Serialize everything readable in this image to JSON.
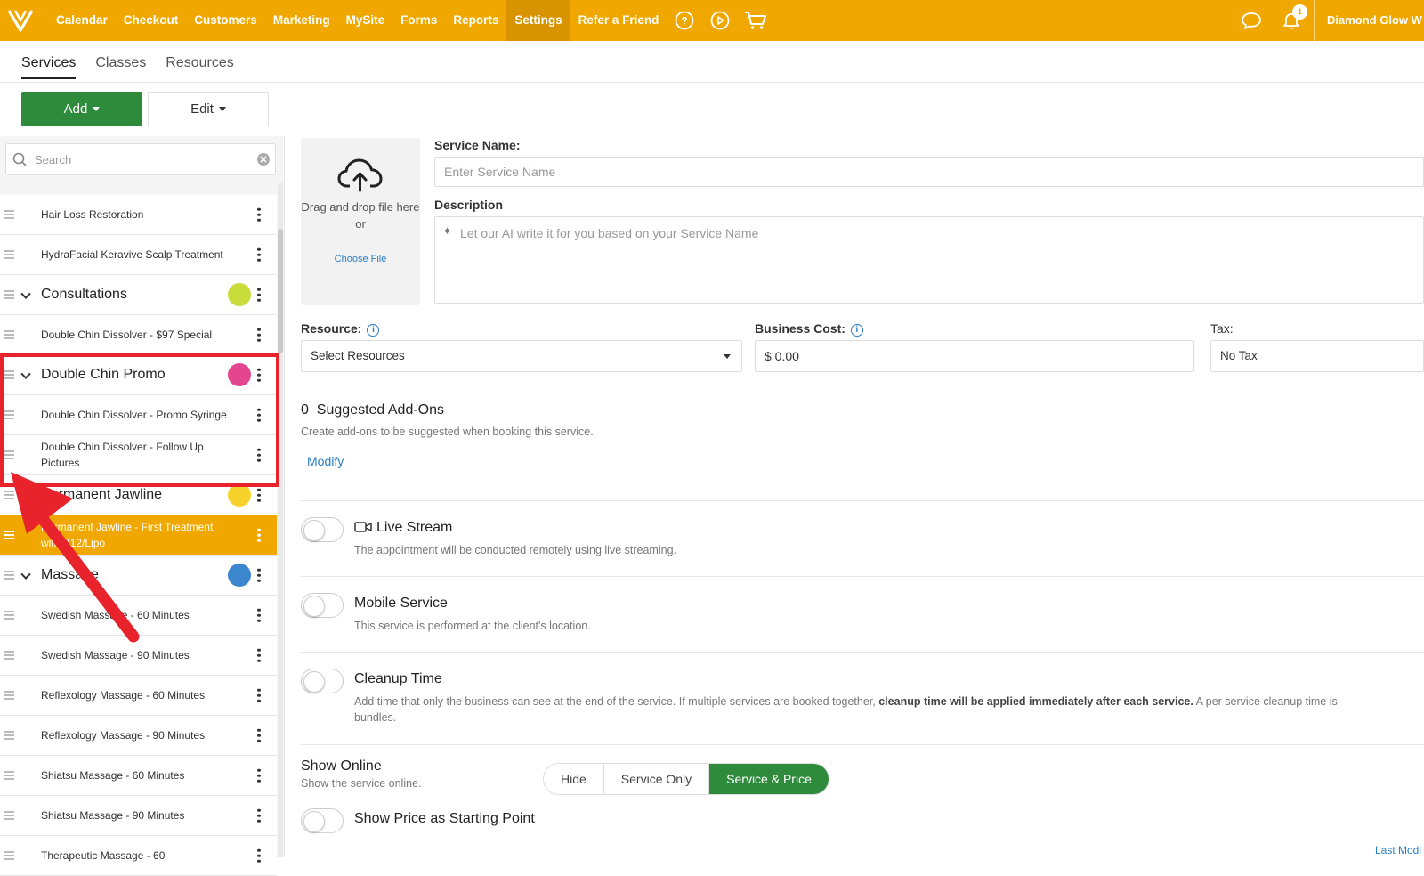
{
  "topnav": {
    "items": [
      "Calendar",
      "Checkout",
      "Customers",
      "Marketing",
      "MySite",
      "Forms",
      "Reports",
      "Settings",
      "Refer a Friend"
    ],
    "active": "Settings",
    "notification_count": "1",
    "account_name": "Diamond Glow W"
  },
  "subtabs": [
    "Services",
    "Classes",
    "Resources"
  ],
  "toolbar": {
    "add_label": "Add",
    "edit_label": "Edit"
  },
  "search": {
    "placeholder": "Search"
  },
  "services": [
    {
      "type": "item",
      "label": "Hair Loss Restoration"
    },
    {
      "type": "item",
      "label": "HydraFacial Keravive Scalp Treatment"
    },
    {
      "type": "category",
      "label": "Consultations",
      "color": "#c8dc3c"
    },
    {
      "type": "item",
      "label": "Double Chin Dissolver - $97 Special"
    },
    {
      "type": "category",
      "label": "Double Chin Promo",
      "color": "#e4458f"
    },
    {
      "type": "item",
      "label": "Double Chin Dissolver - Promo Syringe"
    },
    {
      "type": "item",
      "label": "Double Chin Dissolver - Follow Up Pictures"
    },
    {
      "type": "category",
      "label": "Permanent Jawline",
      "color": "#f7d22c"
    },
    {
      "type": "item",
      "label": "Permanent Jawline - First Treatment with B12/Lipo",
      "selected": true
    },
    {
      "type": "category",
      "label": "Massage",
      "color": "#3c86d0"
    },
    {
      "type": "item",
      "label": "Swedish Massage - 60 Minutes"
    },
    {
      "type": "item",
      "label": "Swedish Massage - 90 Minutes"
    },
    {
      "type": "item",
      "label": "Reflexology Massage - 60 Minutes"
    },
    {
      "type": "item",
      "label": "Reflexology Massage - 90 Minutes"
    },
    {
      "type": "item",
      "label": "Shiatsu Massage - 60 Minutes"
    },
    {
      "type": "item",
      "label": "Shiatsu Massage - 90 Minutes"
    },
    {
      "type": "item",
      "label": "Therapeutic Massage - 60"
    }
  ],
  "upload": {
    "text": "Drag and drop file here or",
    "choose": "Choose File"
  },
  "form": {
    "service_name_label": "Service Name:",
    "service_name_placeholder": "Enter Service Name",
    "description_label": "Description",
    "description_placeholder": "Let our AI write it for you based on your Service Name",
    "resource_label": "Resource:",
    "resource_value": "Select Resources",
    "business_cost_label": "Business Cost:",
    "business_cost_value": "$ 0.00",
    "tax_label": "Tax:",
    "tax_value": "No Tax"
  },
  "addons": {
    "count": "0",
    "title": "Suggested Add-Ons",
    "desc": "Create add-ons to be suggested when booking this service.",
    "modify": "Modify"
  },
  "options": {
    "live_stream": {
      "title": "Live Stream",
      "desc": "The appointment will be conducted remotely using live streaming."
    },
    "mobile": {
      "title": "Mobile Service",
      "desc": "This service is performed at the client's location."
    },
    "cleanup": {
      "title": "Cleanup Time",
      "desc_a": "Add time that only the business can see at the end of the service. If multiple services are booked together, ",
      "desc_bold": "cleanup time will be applied immediately after each service.",
      "desc_b": " A per service cleanup time is",
      "desc_c": "bundles."
    }
  },
  "show_online": {
    "title": "Show Online",
    "desc": "Show the service online.",
    "options": [
      "Hide",
      "Service Only",
      "Service & Price"
    ],
    "active": "Service & Price"
  },
  "starting_point": {
    "title": "Show Price as Starting Point"
  },
  "last_modified": "Last Modi",
  "colors": {
    "brand": "#f0a800",
    "primary_green": "#2e8b3c",
    "link": "#2a7ec7",
    "annotation": "#e8232b"
  }
}
